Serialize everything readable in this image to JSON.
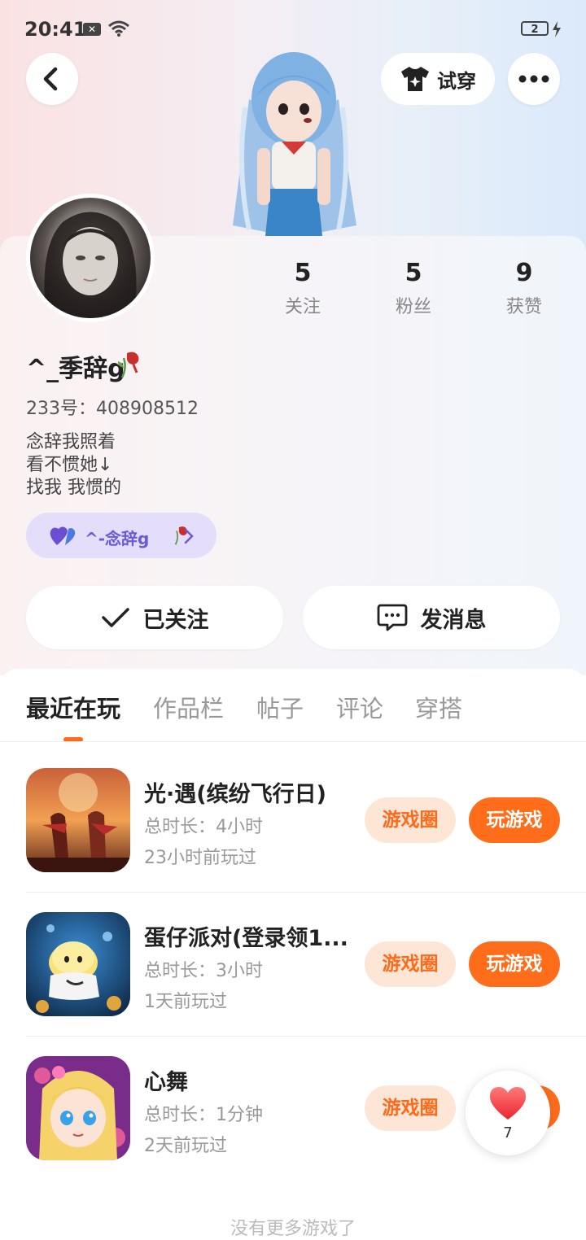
{
  "status_bar": {
    "time": "20:41",
    "battery": "2"
  },
  "header": {
    "try_on_label": "试穿"
  },
  "profile": {
    "username": "^_季辞g",
    "uid_label": "233号：408908512",
    "bio_lines": [
      "念辞我照着",
      "看不惯她↓",
      "找我 我惯的"
    ],
    "cp_name": "^-念辞g",
    "stats": [
      {
        "value": "5",
        "label": "关注"
      },
      {
        "value": "5",
        "label": "粉丝"
      },
      {
        "value": "9",
        "label": "获赞"
      }
    ],
    "follow_label": "已关注",
    "message_label": "发消息"
  },
  "tabs": [
    "最近在玩",
    "作品栏",
    "帖子",
    "评论",
    "穿搭"
  ],
  "active_tab": "最近在玩",
  "games": [
    {
      "name": "光·遇(缤纷飞行日)",
      "duration": "总时长：4小时",
      "last_played": "23小时前玩过",
      "circle_label": "游戏圈",
      "play_label": "玩游戏"
    },
    {
      "name": "蛋仔派对(登录领1...",
      "duration": "总时长：3小时",
      "last_played": "1天前玩过",
      "circle_label": "游戏圈",
      "play_label": "玩游戏"
    },
    {
      "name": "心舞",
      "duration": "总时长：1分钟",
      "last_played": "2天前玩过",
      "circle_label": "游戏圈",
      "play_label": "玩游戏"
    }
  ],
  "footer_text": "没有更多游戏了",
  "like_float": {
    "count": "7"
  },
  "colors": {
    "accent": "#ff6d1b",
    "accent_light": "#fde6d6",
    "cp_pill": "#e4defa",
    "cp_text": "#6a5ad6"
  }
}
